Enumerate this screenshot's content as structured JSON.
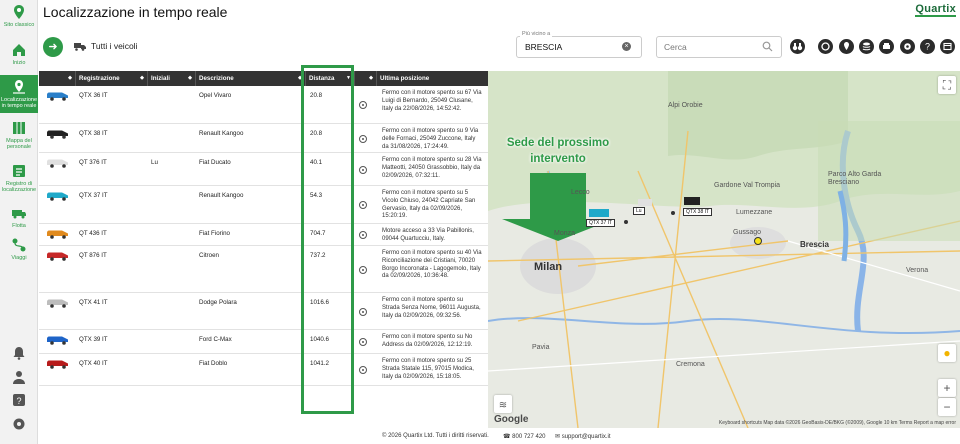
{
  "sidebar": {
    "items": [
      {
        "label": "Sito classico",
        "icon": "map-pin-icon"
      },
      {
        "label": "Inizio",
        "icon": "home-icon"
      },
      {
        "label": "Localizzazione in tempo reale",
        "icon": "location-icon"
      },
      {
        "label": "Mappa del personale",
        "icon": "people-map-icon"
      },
      {
        "label": "Registro di localizzazione",
        "icon": "log-icon"
      },
      {
        "label": "Flotta",
        "icon": "fleet-icon"
      },
      {
        "label": "Viaggi",
        "icon": "trips-icon"
      }
    ],
    "bottom_icons": [
      "bell-icon",
      "user-icon",
      "help-icon",
      "settings-icon"
    ]
  },
  "header": {
    "title": "Localizzazione in tempo reale",
    "logo": "Quartix"
  },
  "toolbar": {
    "vehicles_label": "Tutti i veicoli",
    "near_label": "Più vicino a",
    "near_value": "BRESCIA",
    "search_placeholder": "Cerca",
    "buttons": [
      "binoculars-icon",
      "circle-icon",
      "pin-icon",
      "layers-icon",
      "print-icon",
      "gear-icon",
      "help-icon",
      "window-icon"
    ]
  },
  "table": {
    "columns": [
      "Registrazione",
      "Iniziali",
      "Descrizione",
      "Distanza",
      "Ultima posizione"
    ],
    "rows": [
      {
        "reg": "QTX 36 IT",
        "init": "",
        "desc": "Opel Vivaro",
        "dist": "20.8",
        "pos": "Fermo con il motore spento su 67 Via Luigi di Bernardo, 25049 Clusane, Italy da 22/08/2026, 14:52:42.",
        "color": "#2a7fc9"
      },
      {
        "reg": "QTX 38 IT",
        "init": "",
        "desc": "Renault Kangoo",
        "dist": "20.8",
        "pos": "Fermo con il motore spento su 9 Via delle Fornaci, 25049 Zuccone, Italy da 31/08/2026, 17:24:49.",
        "color": "#222222"
      },
      {
        "reg": "QT 376 IT",
        "init": "Lu",
        "desc": "Fiat Ducato",
        "dist": "40.1",
        "pos": "Fermo con il motore spento su 28 Via Matteotti, 24050 Grassobbio, Italy da 02/09/2026, 07:32:11.",
        "color": "#e0e0e0"
      },
      {
        "reg": "QTX 37 IT",
        "init": "",
        "desc": "Renault Kangoo",
        "dist": "54.3",
        "pos": "Fermo con il motore spento su 5 Vicolo Chiuso, 24042 Capriate San Gervasio, Italy da 02/09/2026, 15:20:19.",
        "color": "#1fa9c9"
      },
      {
        "reg": "QT 436 IT",
        "init": "",
        "desc": "Fiat Fiorino",
        "dist": "704.7",
        "pos": "Motore acceso a 33 Via Pabillonis, 09044 Quartucciu, Italy.",
        "color": "#e08a1e"
      },
      {
        "reg": "QT 876 IT",
        "init": "",
        "desc": "Citroen",
        "dist": "737.2",
        "pos": "Fermo con il motore spento su 40 Via Riconciliazione dei Cristiani, 70020 Borgo Incoronata - Lagogemolo, Italy da 02/09/2026, 10:36:48.",
        "color": "#c62828"
      },
      {
        "reg": "QTX 41 IT",
        "init": "",
        "desc": "Dodge Polara",
        "dist": "1016.6",
        "pos": "Fermo con il motore spento su Strada Senza Nome, 96011 Augusta, Italy da 02/09/2026, 09:32:56.",
        "color": "#bdbdbd"
      },
      {
        "reg": "QTX 39 IT",
        "init": "",
        "desc": "Ford C-Max",
        "dist": "1040.6",
        "pos": "Fermo con il motore spento su No Address da 02/09/2026, 12:12:19.",
        "color": "#1e64c8"
      },
      {
        "reg": "QTX 40 IT",
        "init": "",
        "desc": "Fiat Doblo",
        "dist": "1041.2",
        "pos": "Fermo con il motore spento su 25 Strada Statale 115, 97015 Modica, Italy da 02/09/2026, 15:18:05.",
        "color": "#b71c1c"
      }
    ]
  },
  "map": {
    "annotation_line1": "Sede del prossimo",
    "annotation_line2": "intervento",
    "cities": [
      "Alpi Orobie",
      "Lecco",
      "Lumezzane",
      "Gardone Val Trompia",
      "Brescia",
      "Monza",
      "Milan",
      "Gussago",
      "Verona",
      "Pavia",
      "Cremona",
      "Parco Alto Garda Bresciano"
    ],
    "vehicle_labels": [
      "QTX 37 IT",
      "QTX 38 IT",
      "Lu"
    ],
    "footer": "Keyboard shortcuts   Map data ©2026 GeoBasis-DE/BKG (©2009), Google   10 km   Terms   Report a map error",
    "google": "Google"
  },
  "footer": {
    "copyright": "© 2026 Quartix Ltd. Tutti i diritti riservati.",
    "phone": "800 727 420",
    "email": "support@quartix.it"
  }
}
